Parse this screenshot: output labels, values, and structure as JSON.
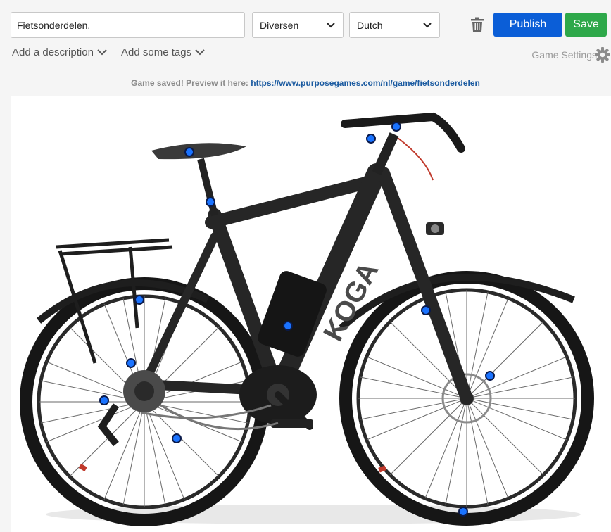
{
  "toolbar": {
    "title_value": "Fietsonderdelen.",
    "category_value": "Diversen",
    "language_value": "Dutch",
    "trash_icon": "trash-icon",
    "publish_label": "Publish",
    "save_label": "Save"
  },
  "subbar": {
    "description_label": "Add a description",
    "tags_label": "Add some tags",
    "settings_label": "Game Settings",
    "settings_icon": "gear-icon"
  },
  "notice": {
    "text": "Game saved! Preview it here:",
    "link": "https://www.purposegames.com/nl/game/fietsonderdelen"
  },
  "colors": {
    "publish": "#0b5ed7",
    "save": "#2ea84a",
    "marker": "#1a73ff",
    "link": "#1a5aa0"
  },
  "image": {
    "subject": "black electric bicycle with KOGA frame lettering",
    "frame_text": "KOGA"
  },
  "markers": [
    {
      "name": "marker-saddle"
    },
    {
      "name": "marker-seatpost"
    },
    {
      "name": "marker-brake-lever"
    },
    {
      "name": "marker-handlebar"
    },
    {
      "name": "marker-rear-suspension"
    },
    {
      "name": "marker-battery"
    },
    {
      "name": "marker-front-fork"
    },
    {
      "name": "marker-cassette"
    },
    {
      "name": "marker-front-disc"
    },
    {
      "name": "marker-derailleur"
    },
    {
      "name": "marker-chain"
    },
    {
      "name": "marker-front-rim"
    }
  ]
}
